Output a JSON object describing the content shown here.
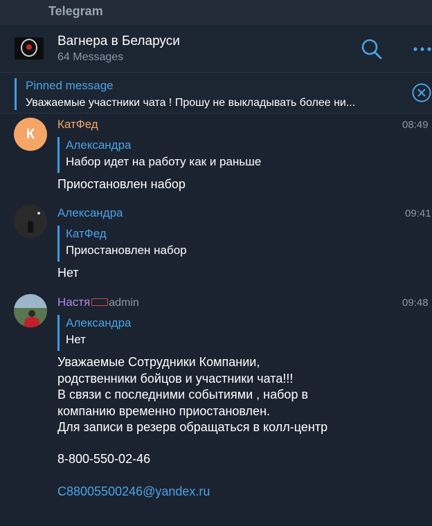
{
  "app": {
    "title": "Telegram"
  },
  "chat": {
    "title": "Вагнера в Беларуси",
    "subtitle": "64 Messages"
  },
  "pinned": {
    "label": "Pinned message",
    "text": "Уважаемые участники чата ! Прошу не выкладывать более ни..."
  },
  "messages": [
    {
      "sender": "КатФед",
      "sender_color": "#f5a667",
      "avatar_letter": "К",
      "time": "08:49",
      "reply_name": "Александра",
      "reply_text": "Набор идет на работу как и раньше",
      "text": "Приостановлен набор"
    },
    {
      "sender": "Александра",
      "sender_color": "#4aa3e6",
      "time": "09:41",
      "reply_name": "КатФед",
      "reply_text": "Приостановлен набор",
      "text": "Нет"
    },
    {
      "sender": "Настя",
      "sender_color": "#b288e8",
      "admin_tag": "admin",
      "time": "09:48",
      "reply_name": "Александра",
      "reply_text": "Нет",
      "text": "Уважаемые Сотрудники Компании,\nродственники бойцов и участники чата!!!\nВ связи с последними событиями , набор в\nкомпанию временно приостановлен.\nДля записи в резерв обращаться в колл-центр",
      "phone": "8-800-550-02-46",
      "email": "C88005500246@yandex.ru"
    }
  ],
  "colors": {
    "accent": "#4aa3e6",
    "background": "#1b2330"
  }
}
